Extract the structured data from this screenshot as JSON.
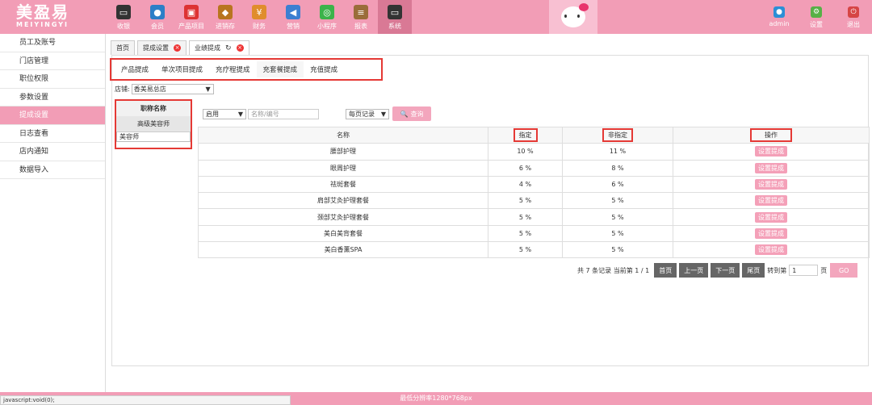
{
  "logo": {
    "cn": "美盈易",
    "en": "MEIYINGYI"
  },
  "nav": [
    {
      "label": "收银",
      "icon": "register-icon",
      "color": "#333"
    },
    {
      "label": "会员",
      "icon": "member-icon",
      "color": "#2c7fc7"
    },
    {
      "label": "产品项目",
      "icon": "product-icon",
      "color": "#d33"
    },
    {
      "label": "进销存",
      "icon": "inventory-icon",
      "color": "#b8751f"
    },
    {
      "label": "财务",
      "icon": "finance-icon",
      "color": "#e08d2c"
    },
    {
      "label": "营销",
      "icon": "marketing-icon",
      "color": "#3c7fd1"
    },
    {
      "label": "小程序",
      "icon": "wechat-icon",
      "color": "#3bb34a"
    },
    {
      "label": "报表",
      "icon": "report-icon",
      "color": "#9a6d3a"
    },
    {
      "label": "系统",
      "icon": "monitor-icon",
      "color": "#333"
    }
  ],
  "right_nav": [
    {
      "label": "admin",
      "icon": "user-icon",
      "color": "#2c8fd6"
    },
    {
      "label": "设置",
      "icon": "settings-icon",
      "color": "#57b046"
    },
    {
      "label": "退出",
      "icon": "logout-icon",
      "color": "#d64545"
    }
  ],
  "sidebar": [
    "员工及账号",
    "门店管理",
    "职位权限",
    "参数设置",
    "提成设置",
    "日志查看",
    "店内通知",
    "数据导入"
  ],
  "page_tabs": [
    {
      "label": "首页"
    },
    {
      "label": "提成设置"
    },
    {
      "label": "业绩提成"
    }
  ],
  "sub_tabs": [
    "产品提成",
    "单次项目提成",
    "充疗程提成",
    "充套餐提成",
    "充值提成"
  ],
  "store": {
    "label": "店铺:",
    "value": "香美易总店"
  },
  "roles": [
    "职称名称",
    "高级美容师",
    "美容师"
  ],
  "filters": {
    "status": "启用",
    "name_placeholder": "名称/编号",
    "per_page": "每页记录",
    "query": "查询"
  },
  "table": {
    "headers": [
      "名称",
      "指定",
      "非指定",
      "操作"
    ],
    "rows": [
      {
        "name": "腰部护理",
        "assigned": "10 %",
        "unassigned": "11 %"
      },
      {
        "name": "眼周护理",
        "assigned": "6 %",
        "unassigned": "8 %"
      },
      {
        "name": "祛斑套餐",
        "assigned": "4 %",
        "unassigned": "6 %"
      },
      {
        "name": "肩部艾灸护理套餐",
        "assigned": "5 %",
        "unassigned": "5 %"
      },
      {
        "name": "颈部艾灸护理套餐",
        "assigned": "5 %",
        "unassigned": "5 %"
      },
      {
        "name": "美白美背套餐",
        "assigned": "5 %",
        "unassigned": "5 %"
      },
      {
        "name": "美白香薰SPA",
        "assigned": "5 %",
        "unassigned": "5 %"
      }
    ],
    "op_label": "设置提成"
  },
  "pager": {
    "summary": "共 7 条记录 当前第 1 / 1",
    "first": "首页",
    "prev": "上一页",
    "next": "下一页",
    "last": "尾页",
    "goto": "转到第",
    "page_value": "1",
    "page_suffix": "页",
    "go": "GO"
  },
  "footer": "最低分辨率1280*768px",
  "status_bar": "javascript:void(0);"
}
